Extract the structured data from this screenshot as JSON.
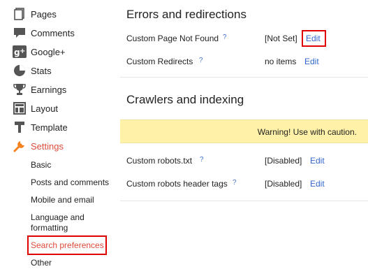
{
  "sidebar": {
    "items": [
      {
        "label": "Pages",
        "icon": "pages-icon"
      },
      {
        "label": "Comments",
        "icon": "comments-icon"
      },
      {
        "label": "Google+",
        "icon": "google-plus-icon"
      },
      {
        "label": "Stats",
        "icon": "stats-icon"
      },
      {
        "label": "Earnings",
        "icon": "earnings-icon"
      },
      {
        "label": "Layout",
        "icon": "layout-icon"
      },
      {
        "label": "Template",
        "icon": "template-icon"
      },
      {
        "label": "Settings",
        "icon": "settings-icon",
        "active": true
      }
    ],
    "settings_subitems": [
      {
        "label": "Basic"
      },
      {
        "label": "Posts and comments"
      },
      {
        "label": "Mobile and email"
      },
      {
        "label": "Language and formatting"
      },
      {
        "label": "Search preferences",
        "selected": true
      },
      {
        "label": "Other"
      }
    ]
  },
  "main": {
    "errors_section": {
      "title": "Errors and redirections",
      "rows": [
        {
          "name": "Custom Page Not Found",
          "help": "?",
          "value": "[Not Set]",
          "action": "Edit"
        },
        {
          "name": "Custom Redirects",
          "help": "?",
          "value": "no items",
          "action": "Edit"
        }
      ]
    },
    "crawlers_section": {
      "title": "Crawlers and indexing",
      "warning": "Warning! Use with caution.",
      "rows": [
        {
          "name": "Custom robots.txt",
          "help": "?",
          "value": "[Disabled]",
          "action": "Edit"
        },
        {
          "name": "Custom robots header tags",
          "help": "?",
          "value": "[Disabled]",
          "action": "Edit"
        }
      ]
    }
  },
  "colors": {
    "accent_orange": "#dd4b39",
    "link_blue": "#3366cc",
    "highlight_red": "#e00000",
    "warning_bg": "#fff1a8",
    "icon_gray": "#555555"
  }
}
